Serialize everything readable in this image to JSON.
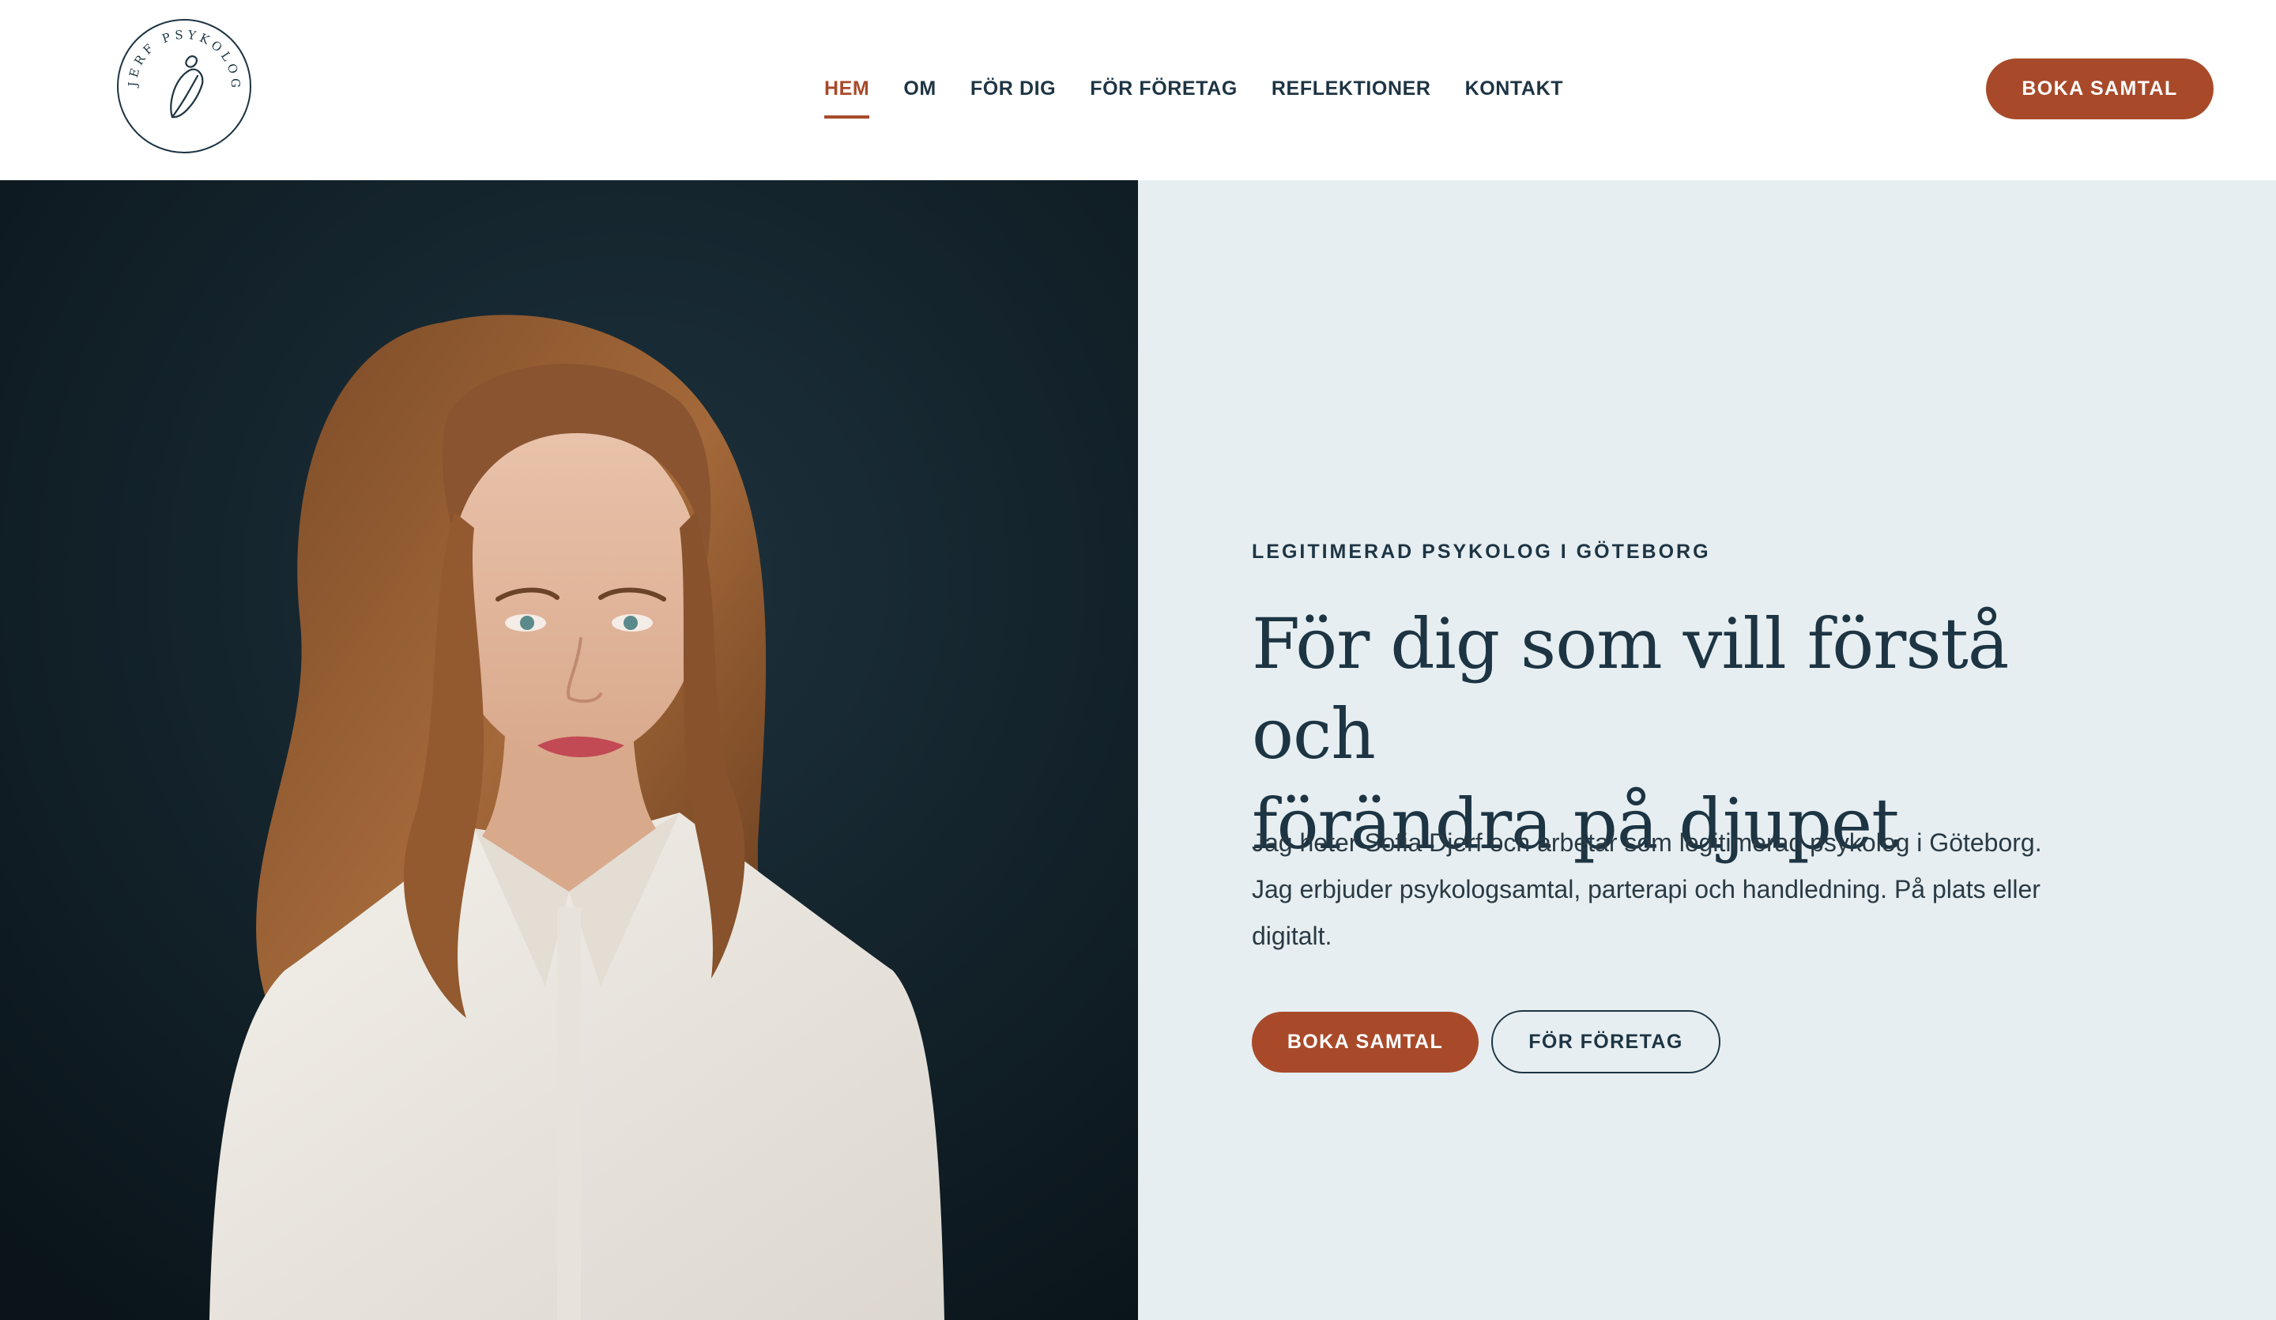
{
  "brand": {
    "logo_ring_text": "DJERF PSYKOLOGI",
    "logo_icon": "abstract-leaf-figure-icon",
    "logo_color": "#1d3443"
  },
  "nav": {
    "items": [
      {
        "label": "HEM",
        "active": true
      },
      {
        "label": "OM",
        "active": false
      },
      {
        "label": "FÖR DIG",
        "active": false
      },
      {
        "label": "FÖR FÖRETAG",
        "active": false
      },
      {
        "label": "REFLEKTIONER",
        "active": false
      },
      {
        "label": "KONTAKT",
        "active": false
      }
    ],
    "cta_label": "BOKA SAMTAL"
  },
  "hero": {
    "eyebrow": "LEGITIMERAD PSYKOLOG I GÖTEBORG",
    "headline_line1": "För dig som vill förstå och",
    "headline_line2": "förändra på djupet",
    "intro_line1": "Jag heter Sofia Djerf och arbetar som legitimerad psykolog i Göteborg.",
    "intro_line2": "Jag erbjuder psykologsamtal, parterapi och handledning. På plats eller",
    "intro_line3": "digitalt.",
    "primary_button": "BOKA SAMTAL",
    "secondary_button": "FÖR FÖRETAG",
    "photo": "portrait-photo"
  },
  "colors": {
    "accent": "#a84a2a",
    "navy": "#1d3443",
    "panel_bg": "#e6eef1",
    "photo_bg": "#0f1c24"
  }
}
